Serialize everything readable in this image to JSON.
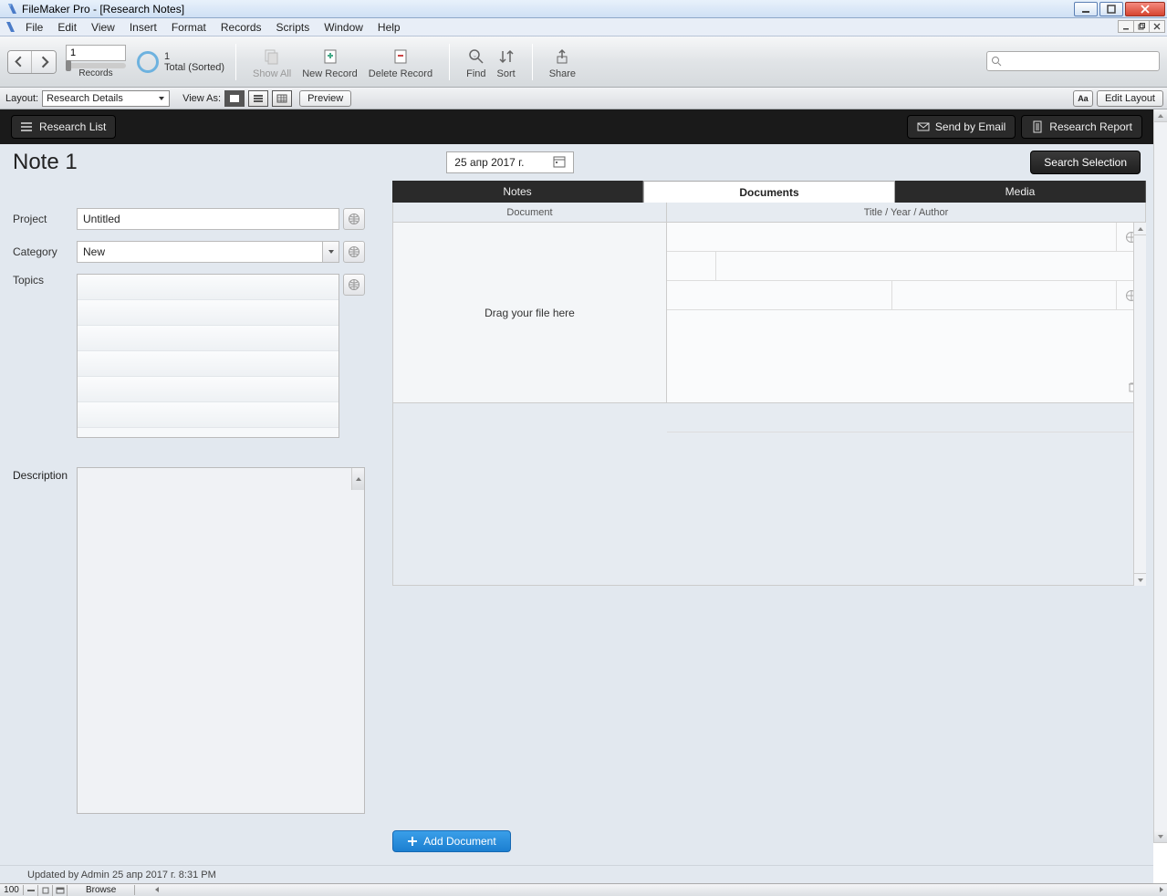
{
  "app_title": "FileMaker Pro - [Research Notes]",
  "menu": [
    "File",
    "Edit",
    "View",
    "Insert",
    "Format",
    "Records",
    "Scripts",
    "Window",
    "Help"
  ],
  "toolbar": {
    "record_num": "1",
    "records_label": "Records",
    "found_count": "1",
    "found_label": "Total (Sorted)",
    "show_all": "Show All",
    "new_record": "New Record",
    "delete_record": "Delete Record",
    "find": "Find",
    "sort": "Sort",
    "share": "Share"
  },
  "layoutbar": {
    "layout_label": "Layout:",
    "layout_value": "Research Details",
    "view_as": "View As:",
    "preview": "Preview",
    "edit_layout": "Edit Layout",
    "aa": "Aa"
  },
  "blackbar": {
    "research_list": "Research List",
    "send_email": "Send by Email",
    "research_report": "Research Report"
  },
  "note": {
    "title": "Note 1",
    "date": "25 апр 2017 г.",
    "search_selection": "Search Selection"
  },
  "form": {
    "project_label": "Project",
    "project_value": "Untitled",
    "category_label": "Category",
    "category_value": "New",
    "topics_label": "Topics",
    "description_label": "Description"
  },
  "tabs": {
    "notes": "Notes",
    "documents": "Documents",
    "media": "Media"
  },
  "doc_header": {
    "document": "Document",
    "tya": "Title / Year / Author"
  },
  "drag_text": "Drag your file here",
  "add_document": "Add Document",
  "updated_text": "Updated by Admin 25 апр 2017 г. 8:31 PM",
  "status": {
    "zoom": "100",
    "mode": "Browse"
  }
}
